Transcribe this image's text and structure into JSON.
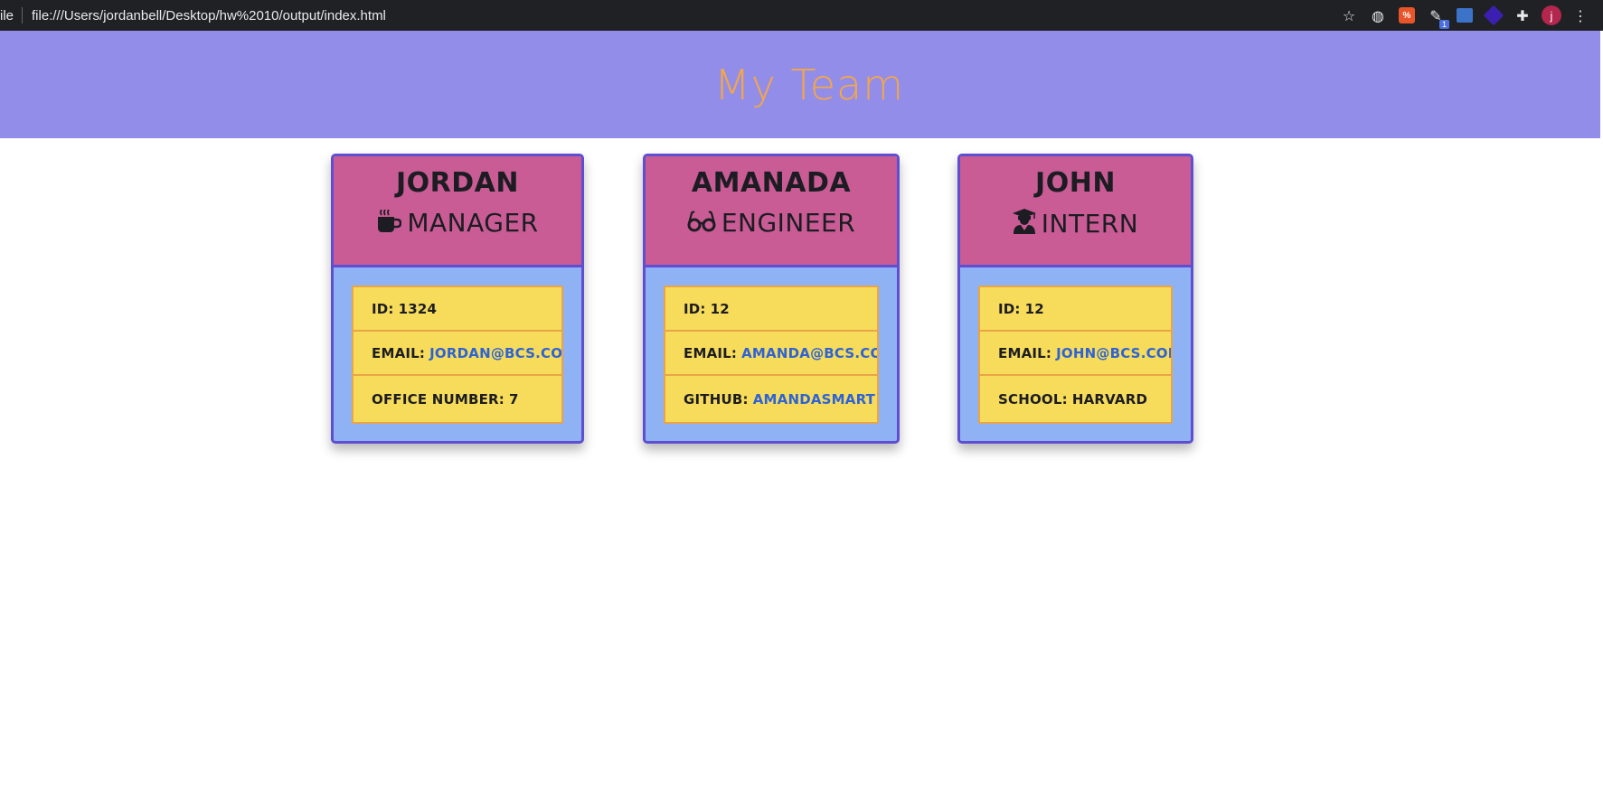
{
  "browser": {
    "scheme_label": "ile",
    "url": "file:///Users/jordanbell/Desktop/hw%2010/output/index.html",
    "avatar_letter": "j",
    "ext_badge": "1",
    "ext_orange_label": "%"
  },
  "header": {
    "title": "My Team"
  },
  "employees": [
    {
      "name": "JORDAN",
      "role": "MANAGER",
      "role_icon": "mug-icon",
      "id_label": "ID:",
      "id": "1324",
      "email_label": "EMAIL:",
      "email": "JORDAN@BCS.COM",
      "extra_label": "OFFICE NUMBER:",
      "extra": "7"
    },
    {
      "name": "AMANADA",
      "role": "ENGINEER",
      "role_icon": "glasses-icon",
      "id_label": "ID:",
      "id": "12",
      "email_label": "EMAIL:",
      "email": "AMANDA@BCS.COM",
      "extra_label": "GITHUB:",
      "extra": "AMANDASMART"
    },
    {
      "name": "JOHN",
      "role": "INTERN",
      "role_icon": "graduate-icon",
      "id_label": "ID:",
      "id": "12",
      "email_label": "EMAIL:",
      "email": "JOHN@BCS.COM",
      "extra_label": "SCHOOL:",
      "extra": "HARVARD"
    }
  ],
  "colors": {
    "header_bg": "#938dea",
    "title": "#f2a64a",
    "card_head": "#c95c95",
    "card_body": "#8fb2f5",
    "card_border": "#5f4ed1",
    "list_item": "#f6dc5a",
    "link": "#2f63d4"
  }
}
